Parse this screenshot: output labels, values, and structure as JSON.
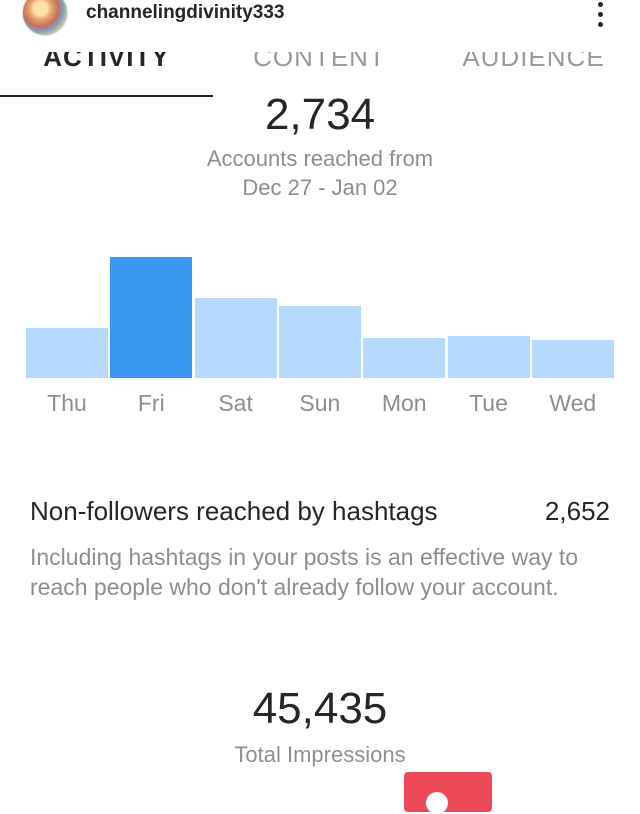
{
  "header": {
    "username": "channelingdivinity333",
    "avatar_icon": "avatar-image",
    "menu_icon": "more-vertical-icon"
  },
  "tabs": [
    {
      "label": "ACTIVITY",
      "active": true
    },
    {
      "label": "CONTENT",
      "active": false
    },
    {
      "label": "AUDIENCE",
      "active": false
    }
  ],
  "reach": {
    "value": "2,734",
    "label_line1": "Accounts reached from",
    "label_line2": "Dec 27 - Jan 02"
  },
  "chart_data": {
    "type": "bar",
    "categories": [
      "Thu",
      "Fri",
      "Sat",
      "Sun",
      "Mon",
      "Tue",
      "Wed"
    ],
    "values": [
      50,
      121,
      80,
      72,
      40,
      42,
      38
    ],
    "highlight": "Fri",
    "colors": {
      "bar": "#b5d9ff",
      "highlight": "#3897f0"
    },
    "xlabel": "",
    "ylabel": ""
  },
  "hashtags": {
    "title": "Non-followers reached by hashtags",
    "value": "2,652",
    "description": "Including hashtags in your posts is an effective way to reach people who don't already follow your account."
  },
  "impressions": {
    "value": "45,435",
    "label": "Total Impressions"
  },
  "colors": {
    "accent": "#3897f0",
    "fab": "#ed4956",
    "muted_text": "#8e8e8e"
  }
}
